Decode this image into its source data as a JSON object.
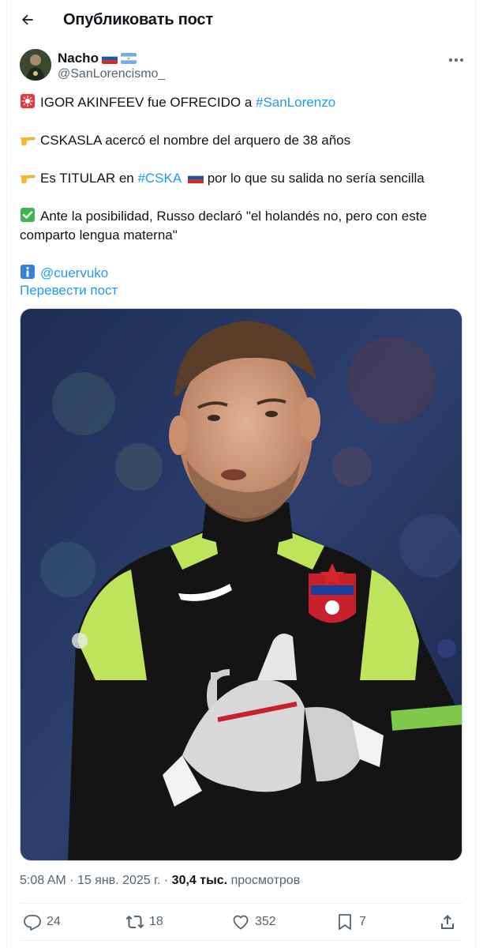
{
  "header": {
    "title": "Опубликовать пост",
    "back_icon": "arrow-left-icon"
  },
  "author": {
    "display_name": "Nacho",
    "handle": "@SanLorencismo_",
    "flags": [
      "russia-flag-icon",
      "argentina-flag-icon"
    ]
  },
  "tweet": {
    "lines": {
      "l1_text": "IGOR AKINFEEV fue OFRECIDO a ",
      "l1_link": "#SanLorenzo",
      "l2_text": "CSKASLA acercó el nombre del arquero de 38 años",
      "l3_pre": "Es TITULAR en ",
      "l3_link": "#CSKA",
      "l3_post": " por lo que su salida no sería sencilla",
      "l4_text": "Ante la posibilidad, Russo declaró \"el holandés no, pero con este",
      "l5_text": "comparto lengua materna\"",
      "l6_mention": "@cuervuko"
    },
    "translate_label": "Перевести пост"
  },
  "meta": {
    "time": "5:08 AM",
    "date": "15 янв. 2025 г.",
    "views_count": "30,4 тыс.",
    "views_label": "просмотров"
  },
  "actions": {
    "replies": "24",
    "retweets": "18",
    "likes": "352",
    "bookmarks": "7"
  },
  "colors": {
    "accent": "#1d9bf0",
    "muted": "#536471",
    "text": "#0f1419"
  }
}
